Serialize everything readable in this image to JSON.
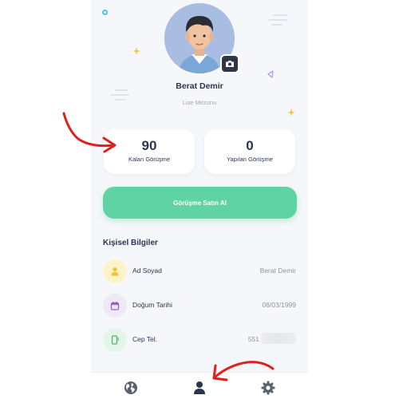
{
  "profile": {
    "name": "Berat Demir",
    "education": "Lise Mezunu"
  },
  "stats": {
    "remaining_value": "90",
    "remaining_label": "Kalan Görüşme",
    "done_value": "0",
    "done_label": "Yapılan Görüşme"
  },
  "buy_button": {
    "label": "Görüşme Satın Al"
  },
  "personal": {
    "title": "Kişisel Bilgiler",
    "rows": [
      {
        "label": "Ad Soyad",
        "value": "Berat Demir",
        "icon": "user-icon"
      },
      {
        "label": "Doğum Tarihi",
        "value": "08/03/1999",
        "icon": "calendar-icon"
      },
      {
        "label": "Cep Tel.",
        "value": "551",
        "icon": "phone-icon"
      }
    ]
  },
  "tabbar": {
    "items": [
      {
        "icon": "globe-icon"
      },
      {
        "icon": "user-icon",
        "active": true
      },
      {
        "icon": "gear-icon"
      }
    ]
  },
  "colors": {
    "accent": "#5fd3a3",
    "text": "#2c3550",
    "muted": "#a1a7b5",
    "annotation": "#e0201d"
  }
}
